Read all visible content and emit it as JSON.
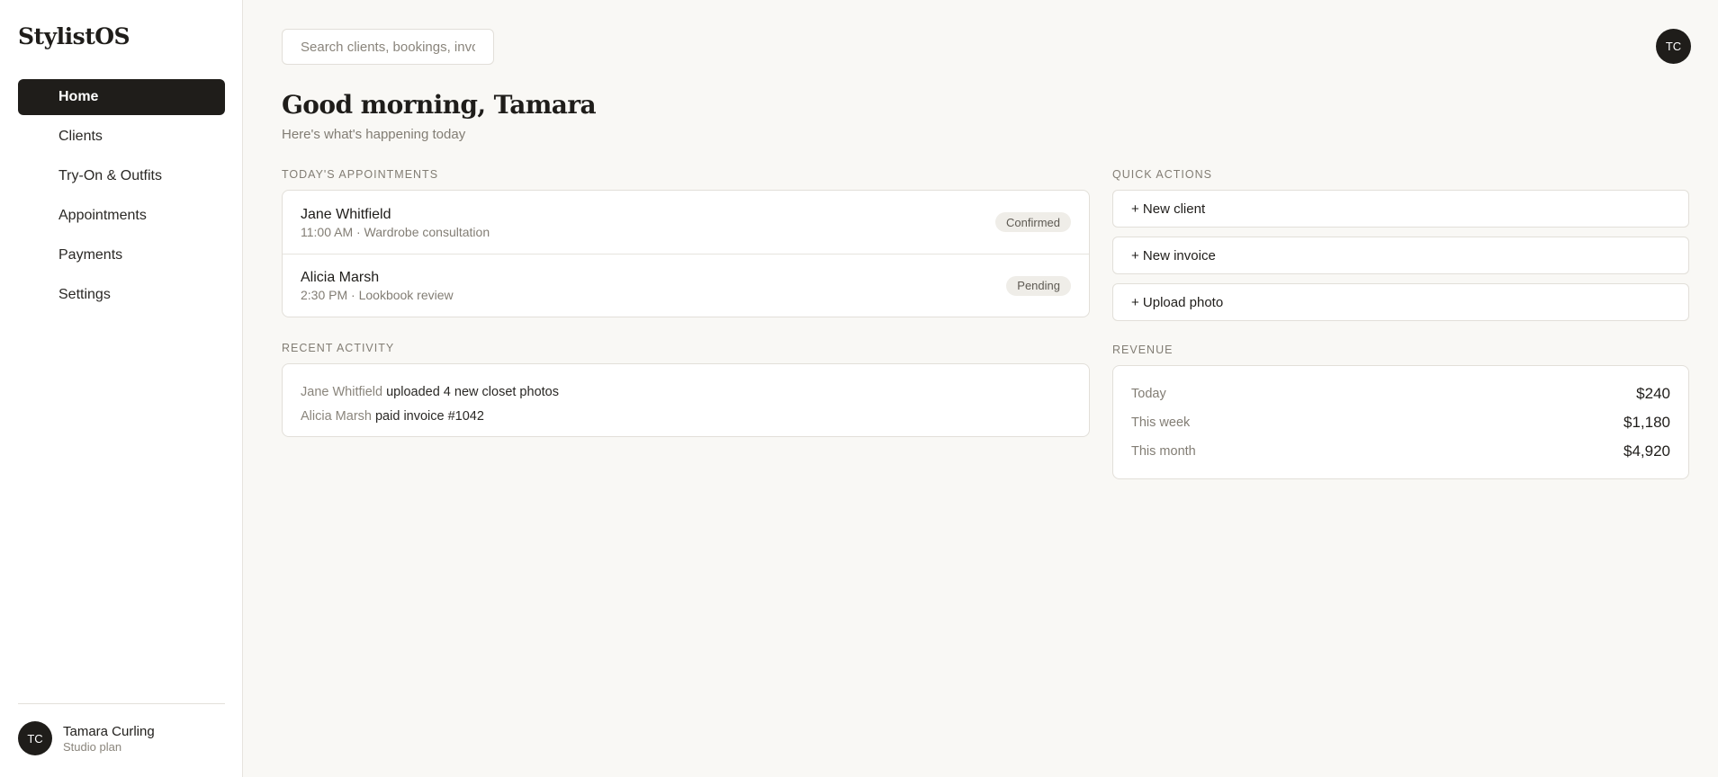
{
  "app": {
    "brand": "StylistOS"
  },
  "sidebar": {
    "items": [
      {
        "label": "Home",
        "active": true
      },
      {
        "label": "Clients"
      },
      {
        "label": "Try-On & Outfits"
      },
      {
        "label": "Appointments"
      },
      {
        "label": "Payments"
      },
      {
        "label": "Settings"
      }
    ],
    "user": {
      "initials": "TC",
      "name": "Tamara Curling",
      "plan": "Studio plan"
    }
  },
  "header": {
    "search_placeholder": "Search clients, bookings, invoices",
    "avatar_initials": "TC"
  },
  "main": {
    "greeting": "Good morning, Tamara",
    "subtitle": "Here's what's happening today",
    "appointments": {
      "label": "TODAY'S APPOINTMENTS",
      "items": [
        {
          "name": "Jane Whitfield",
          "detail": "11:00 AM · Wardrobe consultation",
          "status": "Confirmed"
        },
        {
          "name": "Alicia Marsh",
          "detail": "2:30 PM · Lookbook review",
          "status": "Pending"
        }
      ]
    },
    "activity": {
      "label": "RECENT ACTIVITY",
      "items": [
        {
          "who": "Jane Whitfield",
          "what": " uploaded 4 new closet photos"
        },
        {
          "who": "Alicia Marsh",
          "what": " paid invoice #1042"
        }
      ]
    },
    "quick_actions": {
      "label": "QUICK ACTIONS",
      "items": [
        "+ New client",
        "+ New invoice",
        "+ Upload photo"
      ]
    },
    "revenue": {
      "label": "REVENUE",
      "rows": [
        {
          "label": "Today",
          "value": "$240"
        },
        {
          "label": "This week",
          "value": "$1,180"
        },
        {
          "label": "This month",
          "value": "$4,920"
        }
      ]
    }
  }
}
